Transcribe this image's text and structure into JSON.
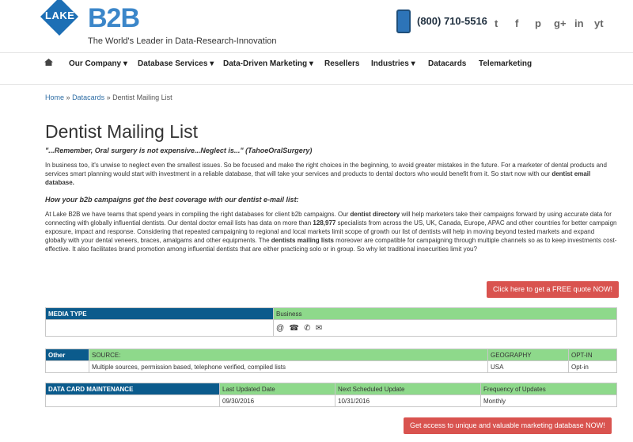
{
  "header": {
    "logo_text": "LAKE",
    "logo_b2b": "B2B",
    "tagline": "The World's Leader in Data-Research-Innovation",
    "phone": "(800) 710-5516",
    "social": [
      "twitter-icon",
      "facebook-icon",
      "pinterest-icon",
      "google-plus-icon",
      "linkedin-icon",
      "youtube-icon"
    ],
    "social_glyphs": [
      "t",
      "f",
      "p",
      "g+",
      "in",
      "yt"
    ]
  },
  "nav": {
    "items": [
      "Our Company",
      "Database Services",
      "Data-Driven Marketing",
      "Resellers",
      "Industries",
      "Datacards",
      "Telemarketing"
    ],
    "dropdown_markers": [
      "▾",
      "▾",
      "▾",
      "",
      "▾",
      "",
      ""
    ]
  },
  "breadcrumb": {
    "home": "Home",
    "sep1": "»",
    "datacards": "Datacards",
    "sep2": "»",
    "current": "Dentist Mailing List"
  },
  "page": {
    "title": "Dentist Mailing List",
    "quote": "\"...Remember, Oral surgery is not expensive...Neglect is...\" (TahoeOralSurgery)",
    "para1_a": "In business too, it's unwise to neglect even the smallest issues. So be focused and make the right choices in the beginning, to avoid greater mistakes in the future. For a marketer of dental products and services smart planning would start with investment in a reliable database, that will take your services and products to dental doctors who would benefit from it. So start now with our ",
    "para1_b": "dentist email database.",
    "subhead": "How your b2b campaigns get the best coverage with our dentist e-mail list:",
    "para2_a": "At Lake B2B we have teams that spend years in compiling the right databases for client b2b campaigns. Our ",
    "para2_b": "dentist directory",
    "para2_c": " will help marketers take their campaigns forward by using accurate data for connecting with globally influential dentists. Our dental doctor email lists has data on more than ",
    "para2_d": "128,977",
    "para2_e": " specialists from across the US, UK, Canada, Europe, APAC and other countries for better campaign exposure, impact and response. Considering that repeated campaigning to regional and local markets limit scope of growth our list of dentists will help in moving beyond tested markets and expand globally with your dental veneers, braces, amalgams and other equipments. The ",
    "para2_f": "dentists mailing lists",
    "para2_g": " moreover are compatible for campaigning through multiple channels so as to keep investments cost-effective. It also facilitates brand promotion among influential dentists that are either practicing solo or in group. So why let traditional insecurities limit you?",
    "quote_button": "Click here to get a FREE quote NOW!",
    "access_button": "Get access to unique and valuable marketing database NOW!"
  },
  "media_table": {
    "header": "MEDIA TYPE",
    "value": "Business",
    "icons": [
      "email-icon",
      "fax-icon",
      "phone-icon",
      "mail-icon"
    ],
    "icon_glyphs": [
      "@",
      "☎",
      "✆",
      "✉"
    ]
  },
  "other_table": {
    "label": "Other",
    "columns": [
      "SOURCE:",
      "GEOGRAPHY",
      "OPT-IN"
    ],
    "row": [
      "Multiple sources, permission based, telephone verified, compiled lists",
      "USA",
      "Opt-in"
    ]
  },
  "datacard_table": {
    "label": "DATA CARD MAINTENANCE",
    "columns": [
      "Last Updated Date",
      "Next Scheduled Update",
      "Frequency of Updates"
    ],
    "row": [
      "09/30/2016",
      "10/31/2016",
      "Monthly"
    ]
  },
  "colors": {
    "dark_blue": "#0b5b8c",
    "green": "#8ed98b",
    "red_button": "#d9534f",
    "link": "#2f6ea5"
  }
}
